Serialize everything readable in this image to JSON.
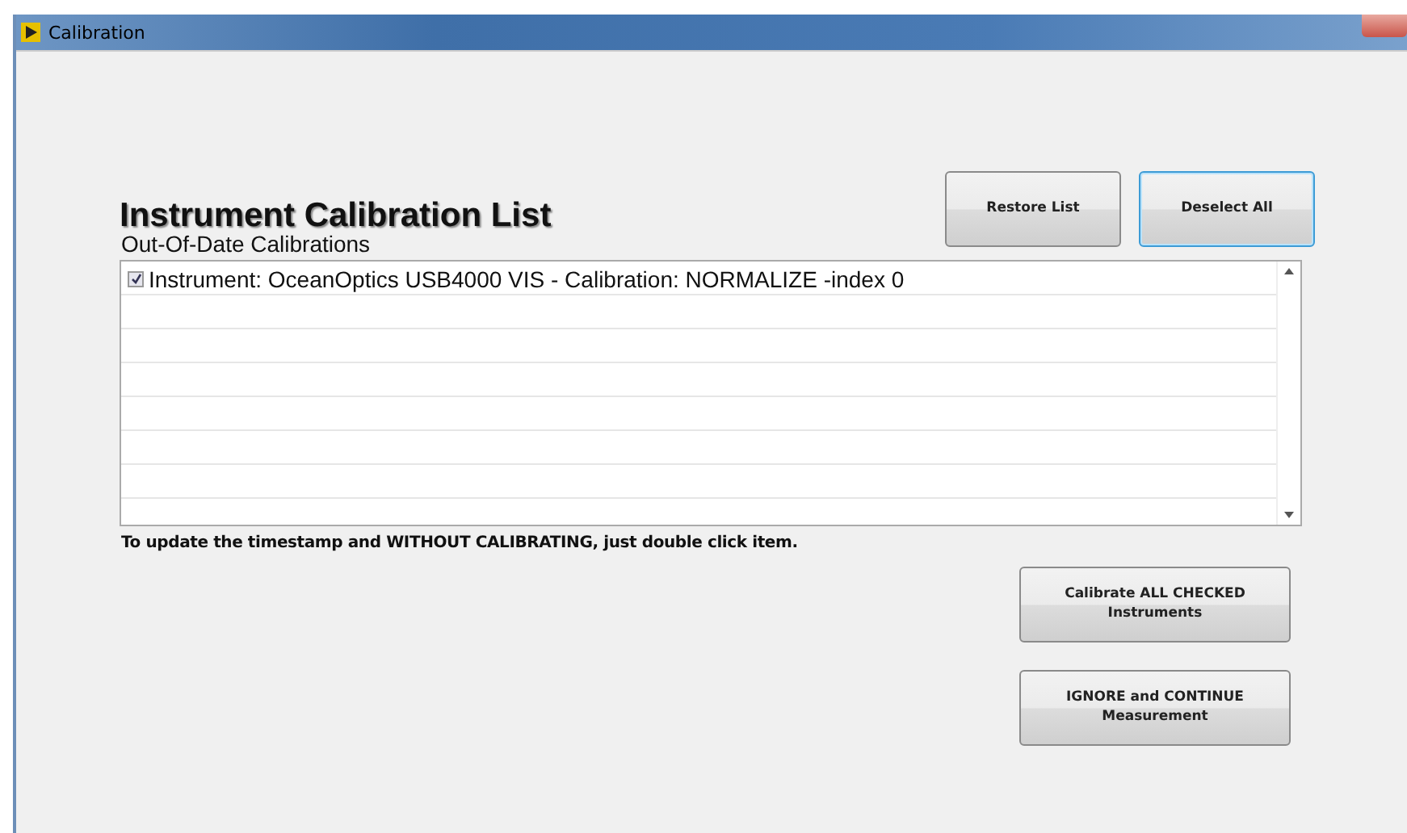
{
  "window": {
    "title": "Calibration"
  },
  "heading": "Instrument Calibration List",
  "top_buttons": [
    {
      "label": "Restore List",
      "focused": false
    },
    {
      "label": "Deselect All",
      "focused": true
    }
  ],
  "list": {
    "label": "Out-Of-Date Calibrations",
    "items": [
      {
        "text": "Instrument: OceanOptics USB4000 VIS - Calibration: NORMALIZE -index 0",
        "checked": true
      }
    ]
  },
  "note": "To update the timestamp and WITHOUT CALIBRATING, just double click item.",
  "action_buttons": [
    {
      "label": "Calibrate ALL CHECKED Instruments",
      "focused": false
    },
    {
      "label": "IGNORE and CONTINUE Measurement",
      "focused": false
    }
  ]
}
